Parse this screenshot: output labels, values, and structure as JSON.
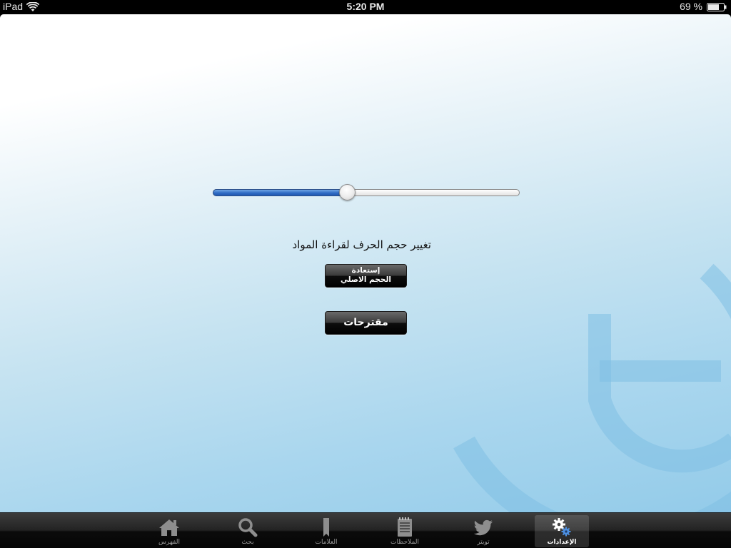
{
  "status_bar": {
    "device": "iPad",
    "time": "5:20 PM",
    "battery": "69 %",
    "wifi_icon": "wifi-icon",
    "battery_icon": "battery-icon"
  },
  "settings": {
    "font_size_label": "تغيير حجم الحرف لقراءة المواد",
    "font_slider_value": 0.44,
    "restore_button": {
      "line1": "إستعادة",
      "line2": "الحجم الاصلي"
    },
    "suggestions_button": "مقترحات"
  },
  "tab_bar": {
    "tabs": [
      {
        "id": "index",
        "label": "الفهرس",
        "icon": "home-icon",
        "selected": false
      },
      {
        "id": "search",
        "label": "بحث",
        "icon": "search-icon",
        "selected": false
      },
      {
        "id": "bookmarks",
        "label": "العلامات",
        "icon": "bookmark-icon",
        "selected": false
      },
      {
        "id": "notes",
        "label": "الملاحظات",
        "icon": "notepad-icon",
        "selected": false
      },
      {
        "id": "twitter",
        "label": "تويتر",
        "icon": "twitter-bird-icon",
        "selected": false
      },
      {
        "id": "settings",
        "label": "الإعدادات",
        "icon": "gears-icon",
        "selected": true
      }
    ],
    "accent_color": "#2f6bc4"
  }
}
